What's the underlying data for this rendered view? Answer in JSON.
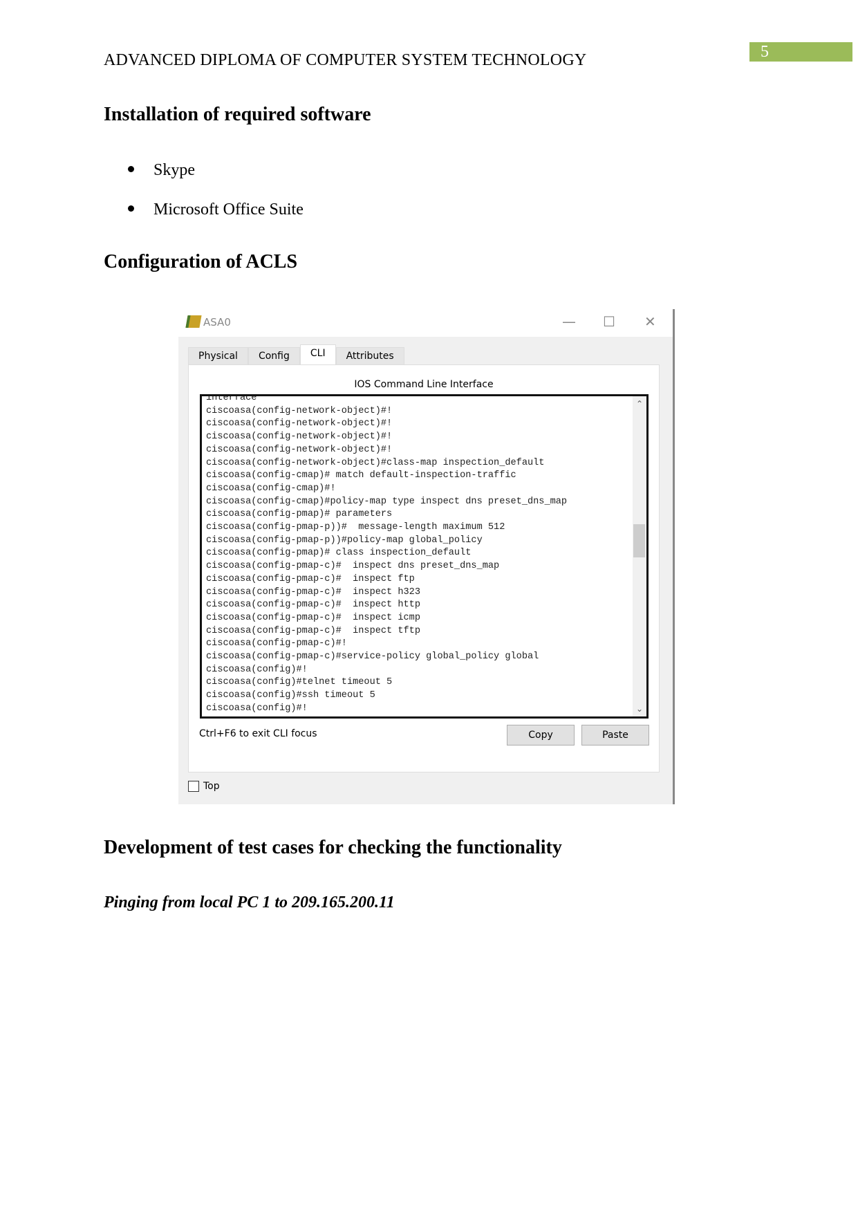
{
  "header": {
    "title": "ADVANCED DIPLOMA OF COMPUTER SYSTEM TECHNOLOGY",
    "page_number": "5",
    "accent": "#9bbb59"
  },
  "section1": {
    "heading": "Installation of required software",
    "bullets": [
      "Skype",
      "Microsoft Office Suite"
    ]
  },
  "section2": {
    "heading": "Configuration of ACLS"
  },
  "window": {
    "title": "ASA0",
    "tabs": [
      "Physical",
      "Config",
      "CLI",
      "Attributes"
    ],
    "active_tab": "CLI",
    "panel_title": "IOS Command Line Interface",
    "cli_lines": [
      "interface",
      "ciscoasa(config-network-object)#!",
      "ciscoasa(config-network-object)#!",
      "ciscoasa(config-network-object)#!",
      "ciscoasa(config-network-object)#!",
      "ciscoasa(config-network-object)#class-map inspection_default",
      "ciscoasa(config-cmap)# match default-inspection-traffic",
      "ciscoasa(config-cmap)#!",
      "ciscoasa(config-cmap)#policy-map type inspect dns preset_dns_map",
      "ciscoasa(config-pmap)# parameters",
      "ciscoasa(config-pmap-p))#  message-length maximum 512",
      "ciscoasa(config-pmap-p))#policy-map global_policy",
      "ciscoasa(config-pmap)# class inspection_default",
      "ciscoasa(config-pmap-c)#  inspect dns preset_dns_map",
      "ciscoasa(config-pmap-c)#  inspect ftp",
      "ciscoasa(config-pmap-c)#  inspect h323",
      "ciscoasa(config-pmap-c)#  inspect http",
      "ciscoasa(config-pmap-c)#  inspect icmp",
      "ciscoasa(config-pmap-c)#  inspect tftp",
      "ciscoasa(config-pmap-c)#!",
      "ciscoasa(config-pmap-c)#service-policy global_policy global",
      "ciscoasa(config)#!",
      "ciscoasa(config)#telnet timeout 5",
      "ciscoasa(config)#ssh timeout 5",
      "ciscoasa(config)#!"
    ],
    "hint": "Ctrl+F6 to exit CLI focus",
    "copy_label": "Copy",
    "paste_label": "Paste",
    "top_label": "Top",
    "top_checked": false
  },
  "section3": {
    "heading": "Development of test cases for checking the functionality",
    "subheading": "Pinging from local PC 1 to 209.165.200.11"
  }
}
